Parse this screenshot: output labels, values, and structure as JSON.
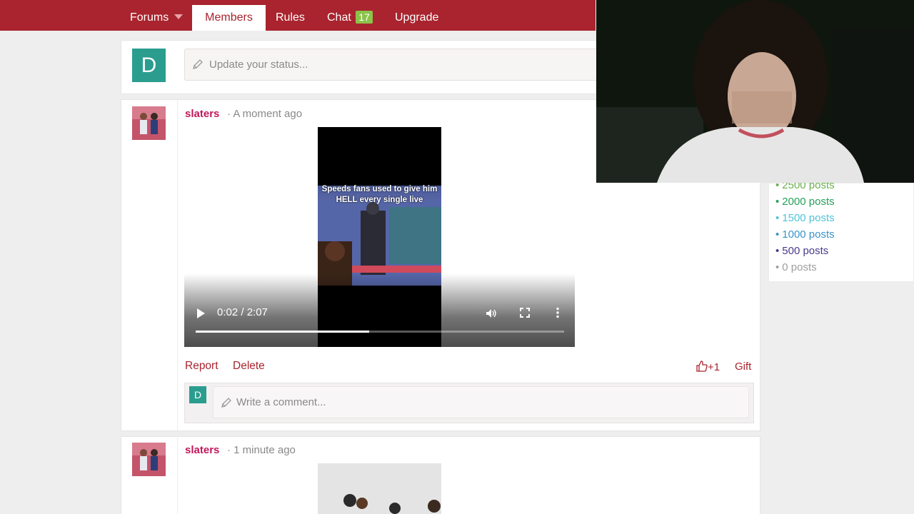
{
  "nav": {
    "items": [
      {
        "label": "Forums"
      },
      {
        "label": "Members"
      },
      {
        "label": "Rules"
      },
      {
        "label": "Chat"
      },
      {
        "label": "Upgrade"
      }
    ],
    "chat_badge": "17",
    "active": "Members"
  },
  "status": {
    "avatar_letter": "D",
    "placeholder": "Update your status..."
  },
  "posts": [
    {
      "username": "slaters",
      "timestamp": "· A moment ago",
      "video": {
        "caption": "Speeds fans used to give him HELL every single live",
        "time": "0:02 / 2:07",
        "progress": 0.47
      },
      "actions": {
        "report": "Report",
        "delete": "Delete",
        "like": "+1",
        "gift": "Gift"
      },
      "comment": {
        "avatar_letter": "D",
        "placeholder": "Write a comment..."
      }
    },
    {
      "username": "slaters",
      "timestamp": "· 1 minute ago"
    }
  ],
  "sidebar": {
    "legend": [
      {
        "label": "2500 posts",
        "color": "#6ab04c"
      },
      {
        "label": "2000 posts",
        "color": "#27a05a"
      },
      {
        "label": "1500 posts",
        "color": "#4fc3d9"
      },
      {
        "label": "1000 posts",
        "color": "#3a93c9"
      },
      {
        "label": "500 posts",
        "color": "#4a3a8a"
      },
      {
        "label": "0 posts",
        "color": "#9e9e9e"
      }
    ]
  },
  "colors": {
    "brand": "#a9242e",
    "username": "#c2185b",
    "avatar": "#2a9d8f",
    "chat_badge": "#8bc34a"
  }
}
